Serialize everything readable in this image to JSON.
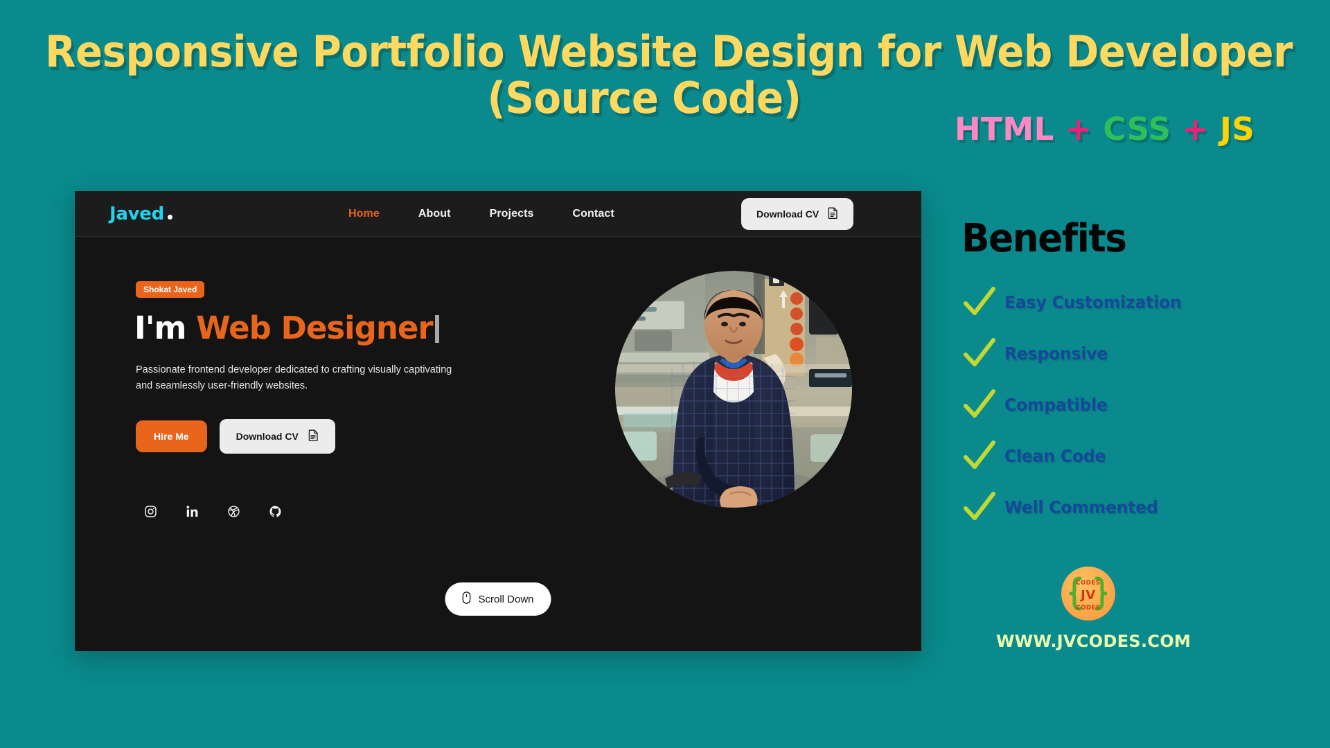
{
  "poster": {
    "headline_line1": "Responsive Portfolio Website Design for Web Developer",
    "headline_line2": "(Source Code)",
    "headline_color": "#ffd95f",
    "background_color": "#0a8a8c",
    "stack": {
      "html": "HTML",
      "plus1": "+",
      "css": "CSS",
      "plus2": "+",
      "js": "JS",
      "html_color": "#ff87c3",
      "plus_color": "#ef1f7a",
      "css_color": "#2fbf5a",
      "js_color": "#ffd400"
    }
  },
  "mockup": {
    "navbar": {
      "logo_text": "Javed",
      "logo_color": "#22d3ee",
      "links": [
        {
          "label": "Home",
          "active": true
        },
        {
          "label": "About",
          "active": false
        },
        {
          "label": "Projects",
          "active": false
        },
        {
          "label": "Contact",
          "active": false
        }
      ],
      "active_link_color": "#e8651b",
      "download_cv_label": "Download CV",
      "download_cv_icon": "document-icon",
      "theme_toggle_icon": "sun-icon"
    },
    "hero": {
      "badge": "Shokat Javed",
      "badge_color": "#e8651b",
      "title_prefix": "I'm",
      "title_role": "Web Designer",
      "role_color": "#e8651b",
      "description": "Passionate frontend developer dedicated to crafting visually captivating and seamlessly user-friendly websites.",
      "primary_button": "Hire Me",
      "secondary_button": "Download CV",
      "secondary_button_icon": "document-icon",
      "socials": [
        {
          "name": "instagram-icon"
        },
        {
          "name": "linkedin-icon"
        },
        {
          "name": "dribbble-icon"
        },
        {
          "name": "github-icon"
        }
      ],
      "photo_alt": "profile-photo",
      "scroll_label": "Scroll Down",
      "scroll_icon": "mouse-icon"
    }
  },
  "benefits": {
    "title": "Benefits",
    "title_color": "#050505",
    "check_color": "#c3d92f",
    "label_color": "#15489b",
    "items": [
      {
        "label": "Easy Customization"
      },
      {
        "label": "Responsive"
      },
      {
        "label": "Compatible"
      },
      {
        "label": "Clean Code"
      },
      {
        "label": "Well Commented"
      }
    ]
  },
  "brand": {
    "logo_name": "jvcodes-logo",
    "logo_top_text": "CODES",
    "logo_center_text": "JV",
    "logo_bottom_text": "CODES",
    "url": "WWW.JVCODES.COM",
    "url_color": "#eaffb0"
  }
}
